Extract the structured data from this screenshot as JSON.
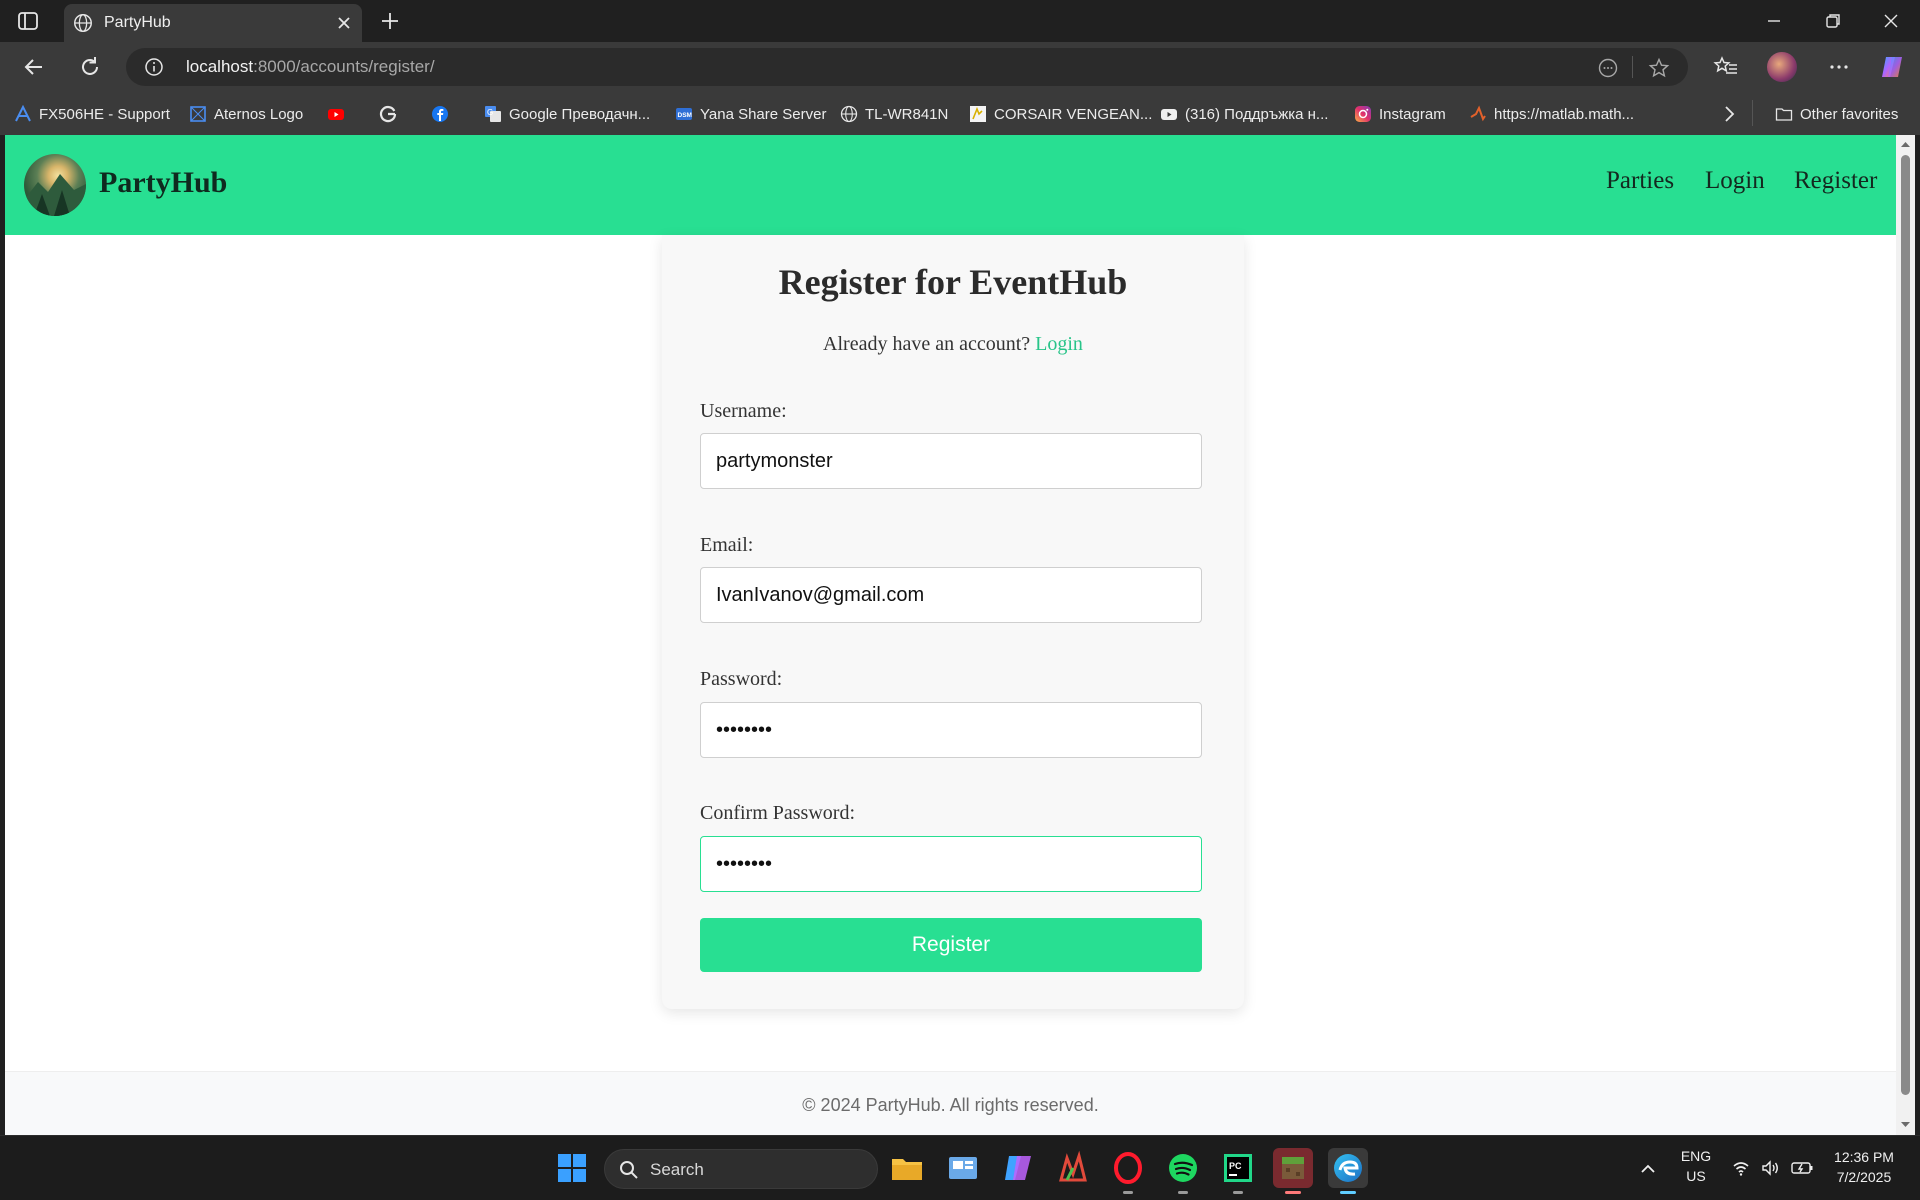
{
  "browser": {
    "tab_title": "PartyHub",
    "url_host": "localhost",
    "url_rest": ":8000/accounts/register/",
    "bookmarks": [
      {
        "label": "FX506HE - Support",
        "icon": "asus-icon"
      },
      {
        "label": "Aternos Logo",
        "icon": "aternos-icon"
      },
      {
        "label": "",
        "icon": "youtube-icon"
      },
      {
        "label": "",
        "icon": "google-icon"
      },
      {
        "label": "",
        "icon": "facebook-icon"
      },
      {
        "label": "Google Преводачн...",
        "icon": "translate-icon"
      },
      {
        "label": "Yana Share Server",
        "icon": "dsm-icon"
      },
      {
        "label": "TL-WR841N",
        "icon": "globe-icon"
      },
      {
        "label": "CORSAIR VENGEAN...",
        "icon": "corsair-icon"
      },
      {
        "label": "(316) Поддръжка н...",
        "icon": "youtube-icon"
      },
      {
        "label": "Instagram",
        "icon": "instagram-icon"
      },
      {
        "label": "https://matlab.math...",
        "icon": "matlab-icon"
      }
    ],
    "other_favorites": "Other favorites"
  },
  "site": {
    "brand": "PartyHub",
    "nav": [
      "Parties",
      "Login",
      "Register"
    ],
    "accent_color": "#28df92"
  },
  "form": {
    "title": "Register for EventHub",
    "already_text": "Already have an account?",
    "login_link": "Login",
    "username_label": "Username:",
    "username_value": "partymonster",
    "email_label": "Email:",
    "email_value": "IvanIvanov@gmail.com",
    "password_label": "Password:",
    "password_value": "••••••••",
    "confirm_label": "Confirm Password:",
    "confirm_value": "••••••••",
    "submit_label": "Register"
  },
  "footer": {
    "text": "© 2024 PartyHub. All rights reserved."
  },
  "taskbar": {
    "search_label": "Search",
    "lang_line1": "ENG",
    "lang_line2": "US",
    "time": "12:36 PM",
    "date": "7/2/2025"
  }
}
